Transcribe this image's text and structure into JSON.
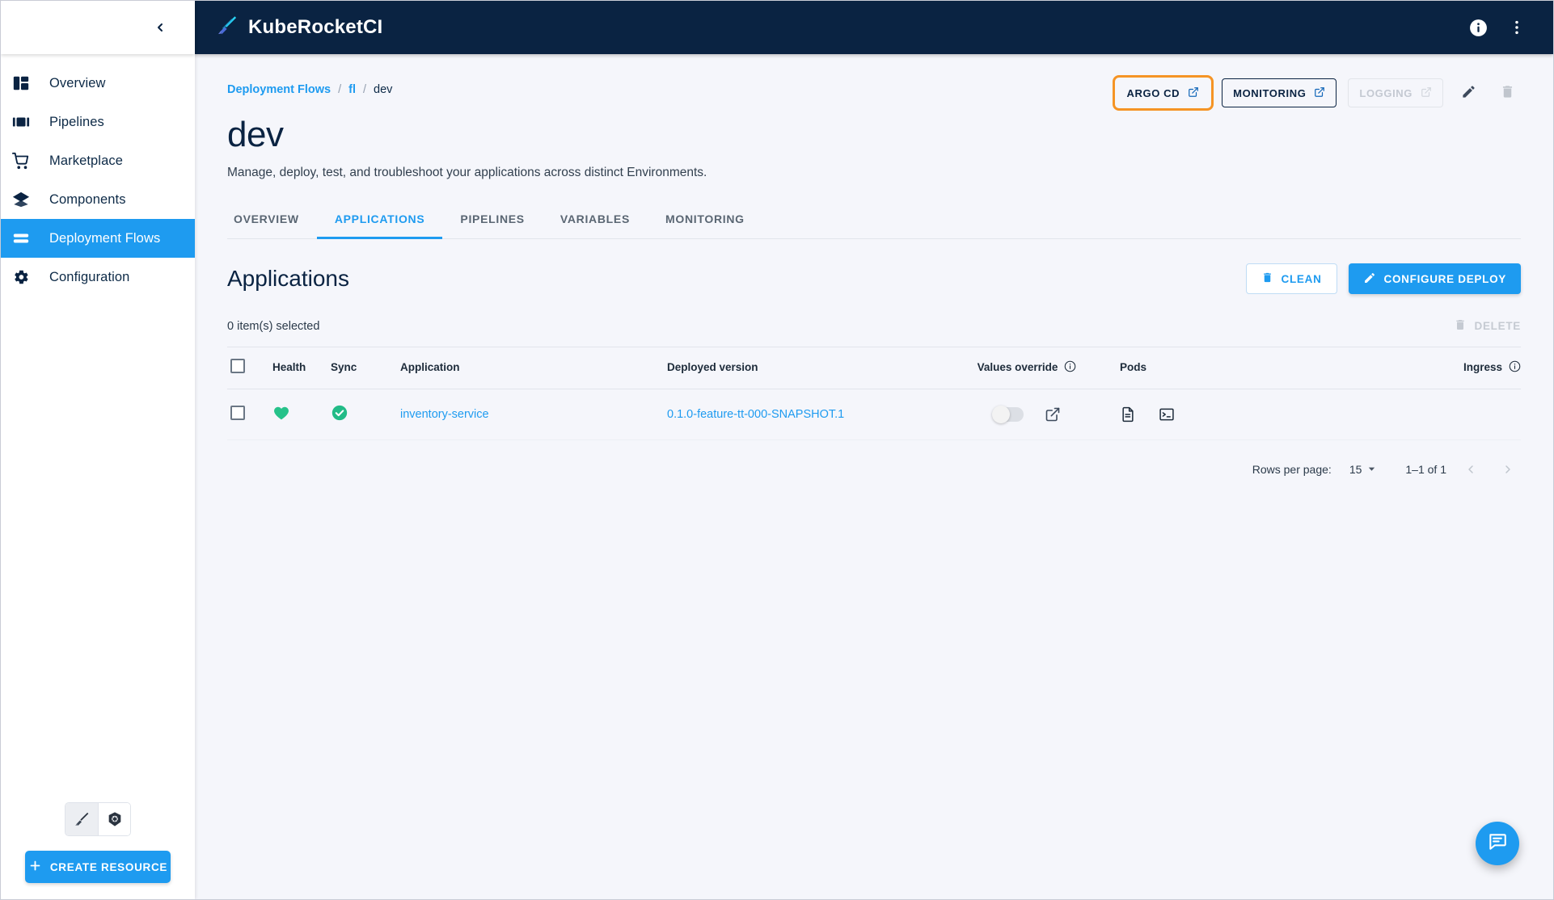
{
  "colors": {
    "accent": "#1e9bf0",
    "header_bg": "#0a2342",
    "page_bg": "#f5f6fb",
    "highlight_outline": "#f59425",
    "health_green": "#26c28a",
    "sync_green": "#22bb87"
  },
  "sidebar": {
    "collapse_icon": "chevron-left-icon",
    "items": [
      {
        "label": "Overview",
        "icon": "dashboard-icon",
        "active": false
      },
      {
        "label": "Pipelines",
        "icon": "pipelines-icon",
        "active": false
      },
      {
        "label": "Marketplace",
        "icon": "cart-icon",
        "active": false
      },
      {
        "label": "Components",
        "icon": "layers-icon",
        "active": false
      },
      {
        "label": "Deployment Flows",
        "icon": "deployment-flows-icon",
        "active": true
      },
      {
        "label": "Configuration",
        "icon": "gear-icon",
        "active": false
      }
    ],
    "bottom": {
      "toggle_left_icon": "krci-rocket-icon",
      "toggle_right_icon": "kubernetes-icon",
      "create_resource_label": "CREATE RESOURCE",
      "create_resource_icon": "plus-icon"
    }
  },
  "topbar": {
    "logo_icon": "krci-rocket-icon",
    "title": "KubeRocketCI",
    "info_icon": "info-icon",
    "menu_icon": "more-vertical-icon"
  },
  "breadcrumb": {
    "items": [
      {
        "label": "Deployment Flows",
        "type": "link"
      },
      {
        "label": "/",
        "type": "sep"
      },
      {
        "label": "fl",
        "type": "link"
      },
      {
        "label": "/",
        "type": "sep"
      },
      {
        "label": "dev",
        "type": "current"
      }
    ]
  },
  "header_actions": {
    "argo_cd": {
      "label": "ARGO CD",
      "icon": "external-link-icon",
      "highlighted": true,
      "disabled": false
    },
    "monitoring": {
      "label": "MONITORING",
      "icon": "external-link-icon",
      "highlighted": false,
      "disabled": false
    },
    "logging": {
      "label": "LOGGING",
      "icon": "external-link-icon",
      "highlighted": false,
      "disabled": true
    },
    "edit_icon": "pencil-icon",
    "delete_icon": "trash-icon"
  },
  "page": {
    "title": "dev",
    "subtitle": "Manage, deploy, test, and troubleshoot your applications across distinct Environments."
  },
  "tabs": [
    {
      "label": "OVERVIEW",
      "active": false
    },
    {
      "label": "APPLICATIONS",
      "active": true
    },
    {
      "label": "PIPELINES",
      "active": false
    },
    {
      "label": "VARIABLES",
      "active": false
    },
    {
      "label": "MONITORING",
      "active": false
    }
  ],
  "applications_section": {
    "title": "Applications",
    "clean_label": "CLEAN",
    "clean_icon": "trash-icon",
    "configure_label": "CONFIGURE DEPLOY",
    "configure_icon": "pencil-icon",
    "selection_text": "0 item(s) selected",
    "delete_label": "DELETE",
    "delete_icon": "trash-icon"
  },
  "table": {
    "columns": [
      {
        "key": "check",
        "label": "",
        "info": false
      },
      {
        "key": "health",
        "label": "Health",
        "info": false
      },
      {
        "key": "sync",
        "label": "Sync",
        "info": false
      },
      {
        "key": "application",
        "label": "Application",
        "info": false
      },
      {
        "key": "version",
        "label": "Deployed version",
        "info": false
      },
      {
        "key": "values",
        "label": "Values override",
        "info": true
      },
      {
        "key": "pods",
        "label": "Pods",
        "info": false
      },
      {
        "key": "ingress",
        "label": "Ingress",
        "info": true
      }
    ],
    "rows": [
      {
        "checked": false,
        "health": {
          "icon": "heart-icon",
          "status": "Healthy"
        },
        "sync": {
          "icon": "check-circle-icon",
          "status": "Synced"
        },
        "application": "inventory-service",
        "version": "0.1.0-feature-tt-000-SNAPSHOT.1",
        "values_override": {
          "toggle": "off",
          "external_icon": "external-link-icon"
        },
        "pods": [
          "document-icon",
          "terminal-icon"
        ],
        "ingress": ""
      }
    ]
  },
  "pagination": {
    "rows_per_page_label": "Rows per page:",
    "rows_per_page_value": "15",
    "range_label": "1–1 of 1",
    "prev_icon": "chevron-left-icon",
    "next_icon": "chevron-right-icon",
    "dropdown_icon": "chevron-down-icon"
  },
  "fab": {
    "icon": "chat-icon"
  }
}
